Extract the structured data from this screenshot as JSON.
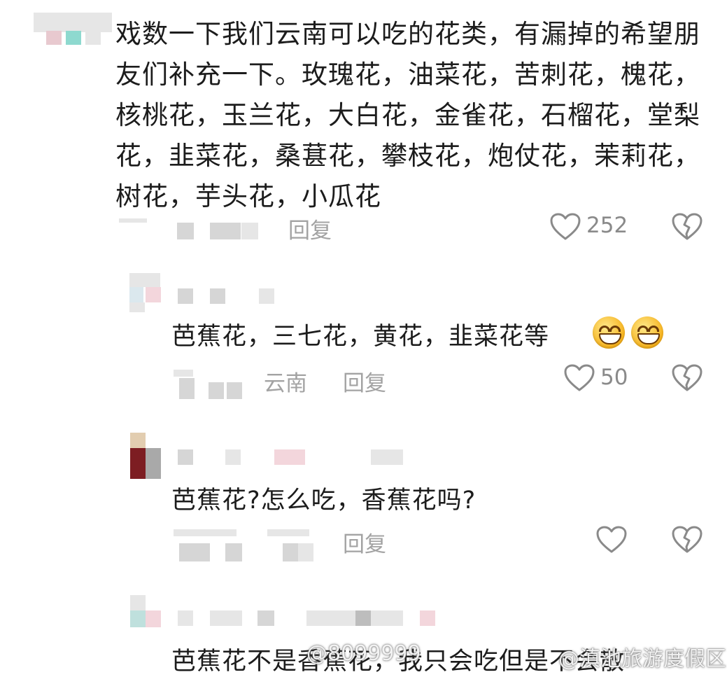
{
  "comments": [
    {
      "text": "戏数一下我们云南可以吃的花类，有漏掉的希望朋友们补充一下。玫瑰花，油菜花，苦刺花，槐花，核桃花，玉兰花，大白花，金雀花，石榴花，堂梨花，韭菜花，桑葚花，攀枝花，炮仗花，茉莉花，树花，芋头花，小瓜花",
      "reply_label": "回复",
      "like_count": "252"
    },
    {
      "text": "芭蕉花，三七花，黄花，韭菜花等",
      "location": "云南",
      "reply_label": "回复",
      "like_count": "50",
      "emoji": [
        "grinning-emoji",
        "grinning-emoji"
      ]
    },
    {
      "text": "芭蕉花?怎么吃，香蕉花吗?",
      "reply_label": "回复",
      "like_count": ""
    },
    {
      "text": "芭蕉花不是香蕉花，我只会吃但是不会散"
    }
  ],
  "watermark": {
    "left": "@8099999",
    "right": "@滇池旅游度假区"
  },
  "colors": {
    "text": "#1c1c1c",
    "meta": "#a3a3a3",
    "icon": "#8a8a8a"
  }
}
